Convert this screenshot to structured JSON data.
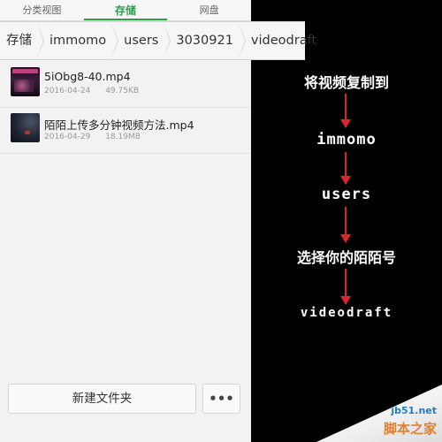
{
  "tabs": [
    {
      "label": "分类视图",
      "active": false
    },
    {
      "label": "存储",
      "active": true
    },
    {
      "label": "网盘",
      "active": false
    }
  ],
  "breadcrumb": [
    "存储",
    "immomo",
    "users",
    "3030921",
    "videodraft"
  ],
  "files": [
    {
      "name": "5iObg8-40.mp4",
      "date": "2016-04-24",
      "size": "49.75KB"
    },
    {
      "name": "陌陌上传多分钟视频方法.mp4",
      "date": "2016-04-29",
      "size": "18.19MB"
    }
  ],
  "bottom": {
    "new_folder_label": "新建文件夹",
    "more_label": "•••"
  },
  "instructions": {
    "title": "将视频复制到",
    "step1": "immomo",
    "step2": "users",
    "step3": "选择你的陌陌号",
    "step4": "videodraft"
  },
  "watermark": {
    "site": "jb51.net",
    "name": "脚本之家"
  },
  "colors": {
    "accent": "#2c9f51",
    "arrow": "#d8262c"
  }
}
